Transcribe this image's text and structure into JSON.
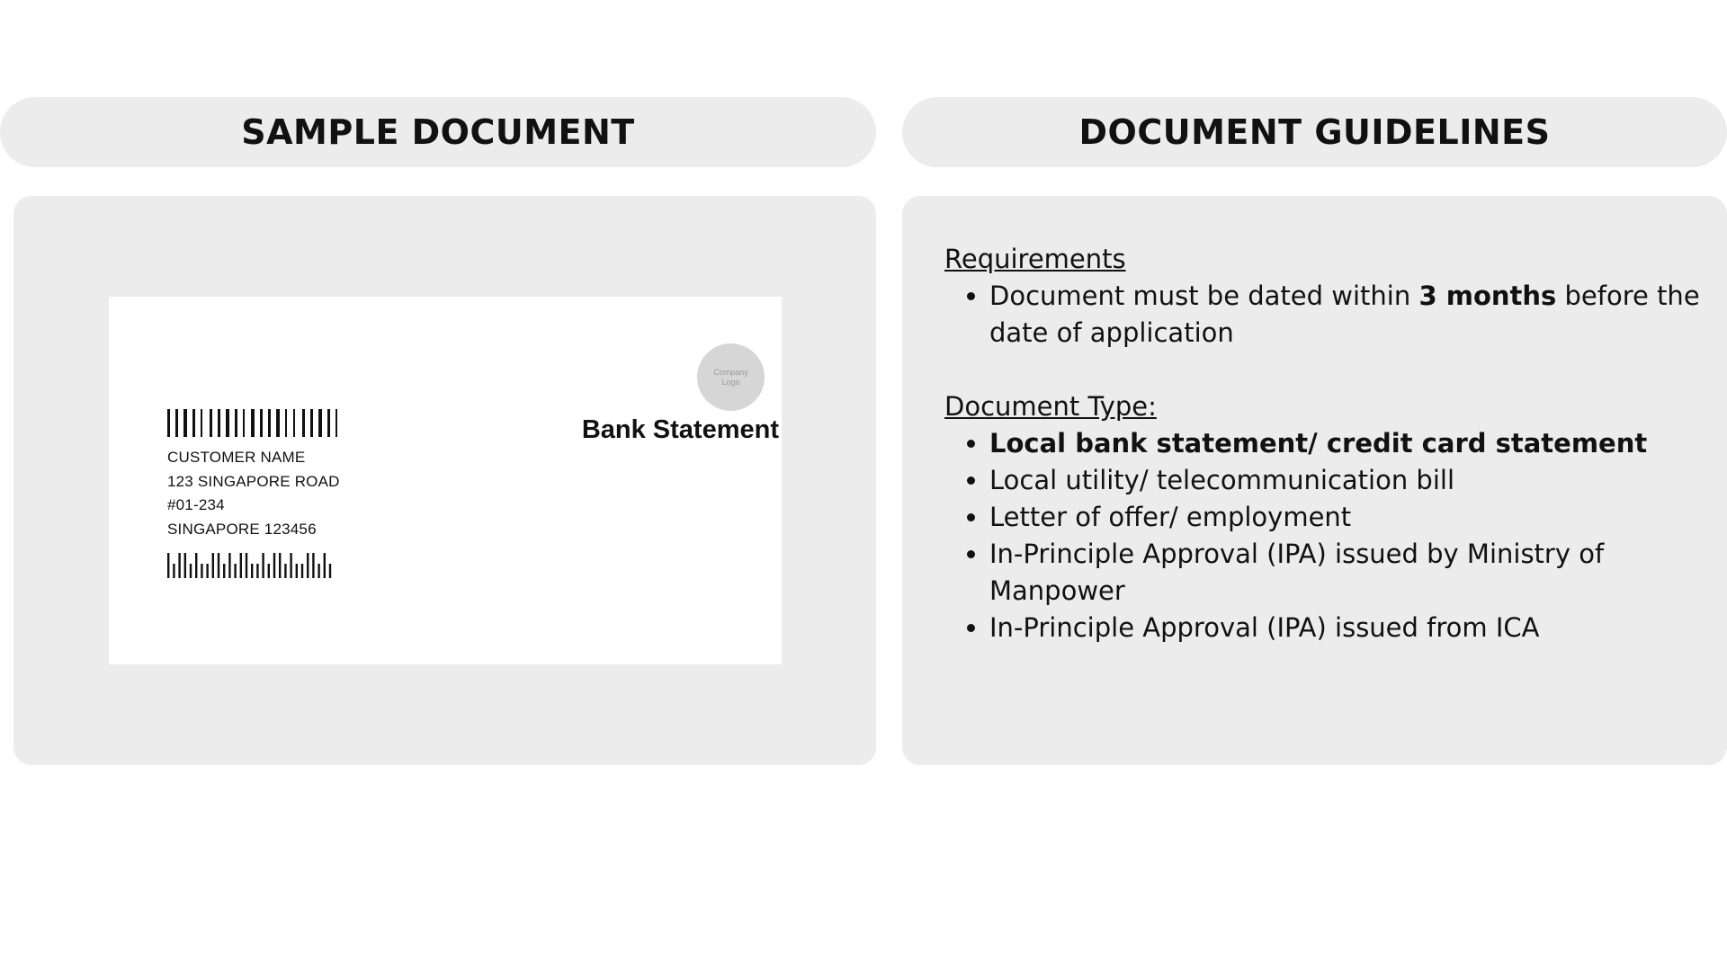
{
  "headers": {
    "left": "SAMPLE DOCUMENT",
    "right": "DOCUMENT GUIDELINES"
  },
  "sample_document": {
    "logo_text": "Company Logo",
    "title": "Bank Statement",
    "address_lines": [
      "CUSTOMER NAME",
      "123 SINGAPORE ROAD",
      "#01-234",
      "SINGAPORE 123456"
    ]
  },
  "guidelines": {
    "requirements_title": "Requirements",
    "requirement_prefix": "Document must be dated within ",
    "requirement_bold": "3 months",
    "requirement_suffix": " before the date of application",
    "doc_type_title": "Document Type:",
    "doc_types": [
      "Local bank statement/ credit card statement",
      "Local utility/ telecommunication bill",
      "Letter of offer/ employment",
      "In-Principle Approval (IPA) issued by Ministry of Manpower",
      "In-Principle Approval (IPA) issued from ICA"
    ]
  },
  "colors": {
    "panel_bg": "#ececec",
    "card_bg": "#ffffff",
    "text": "#111111"
  }
}
